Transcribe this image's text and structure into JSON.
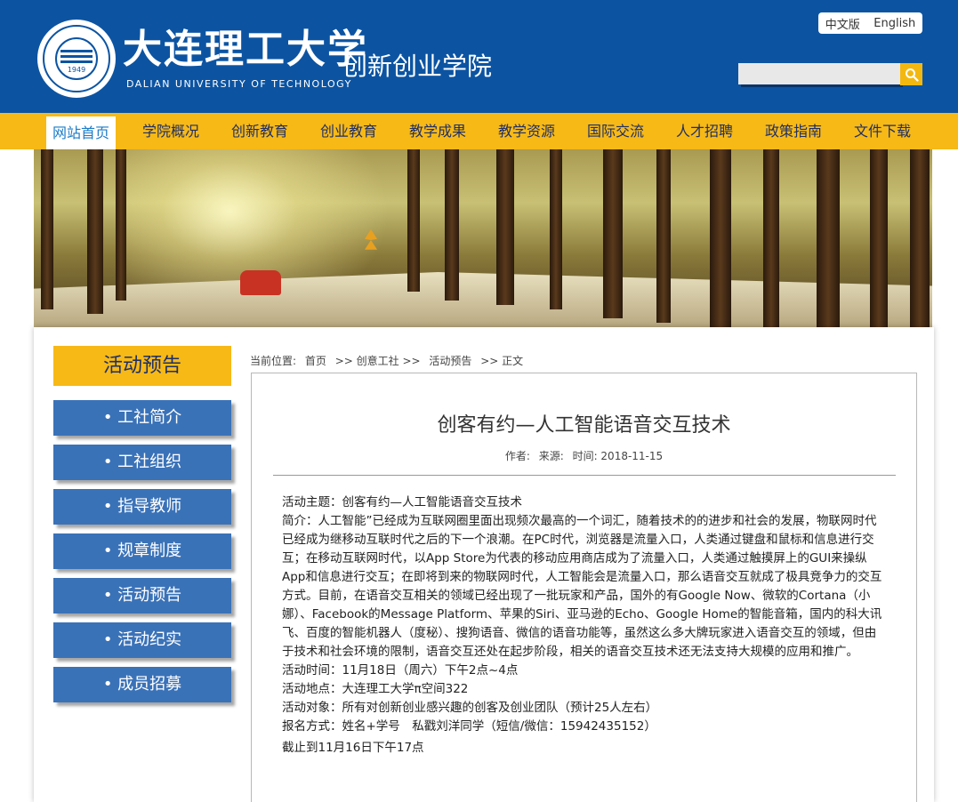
{
  "header": {
    "seal_year": "1949",
    "university_cn": "大连理工大学",
    "university_en": "DALIAN UNIVERSITY OF TECHNOLOGY",
    "college_name": "创新创业学院",
    "lang_cn": "中文版",
    "lang_en": "English",
    "search_placeholder": "",
    "colors": {
      "header_bg": "#0c54a2",
      "accent": "#f7b916"
    }
  },
  "nav": {
    "items": [
      {
        "label": "网站首页",
        "active": true
      },
      {
        "label": "学院概况"
      },
      {
        "label": "创新教育"
      },
      {
        "label": "创业教育"
      },
      {
        "label": "教学成果"
      },
      {
        "label": "教学资源"
      },
      {
        "label": "国际交流"
      },
      {
        "label": "人才招聘"
      },
      {
        "label": "政策指南"
      },
      {
        "label": "文件下载"
      }
    ]
  },
  "sidebar": {
    "title": "活动预告",
    "items": [
      {
        "label": "• 工社简介"
      },
      {
        "label": "• 工社组织"
      },
      {
        "label": "• 指导教师"
      },
      {
        "label": "• 规章制度"
      },
      {
        "label": "• 活动预告"
      },
      {
        "label": "• 活动纪实"
      },
      {
        "label": "• 成员招募"
      }
    ]
  },
  "breadcrumb": {
    "prefix": "当前位置:",
    "items": [
      "首页",
      ">> 创意工社 >>",
      "活动预告",
      ">> 正文"
    ]
  },
  "article": {
    "title": "创客有约—人工智能语音交互技术",
    "meta": {
      "author": "作者:",
      "source": "来源:",
      "time": "时间: 2018-11-15"
    },
    "paragraphs": [
      "活动主题：创客有约—人工智能语音交互技术",
      "简介：人工智能”已经成为互联网圈里面出现频次最高的一个词汇，随着技术的的进步和社会的发展，物联网时代已经成为继移动互联时代之后的下一个浪潮。在PC时代，浏览器是流量入口，人类通过键盘和鼠标和信息进行交互；在移动互联网时代，以App Store为代表的移动应用商店成为了流量入口，人类通过触摸屏上的GUI来操纵App和信息进行交互；在即将到来的物联网时代，人工智能会是流量入口，那么语音交互就成了极具竞争力的交互方式。目前，在语音交互相关的领域已经出现了一批玩家和产品，国外的有Google Now、微软的Cortana（小娜）、Facebook的Message Platform、苹果的Siri、亚马逊的Echo、Google Home的智能音箱，国内的科大讯飞、百度的智能机器人（度秘）、搜狗语音、微信的语音功能等，虽然这么多大牌玩家进入语音交互的领域，但由于技术和社会环境的限制，语音交互还处在起步阶段，相关的语音交互技术还无法支持大规模的应用和推广。",
      "活动时间：11月18日（周六）下午2点~4点",
      "活动地点：大连理工大学π空间322",
      "活动对象：所有对创新创业感兴趣的创客及创业团队（预计25人左右）",
      "报名方式：姓名+学号　私戳刘洋同学（短信/微信：15942435152）",
      "截止到11月16日下午17点"
    ]
  }
}
